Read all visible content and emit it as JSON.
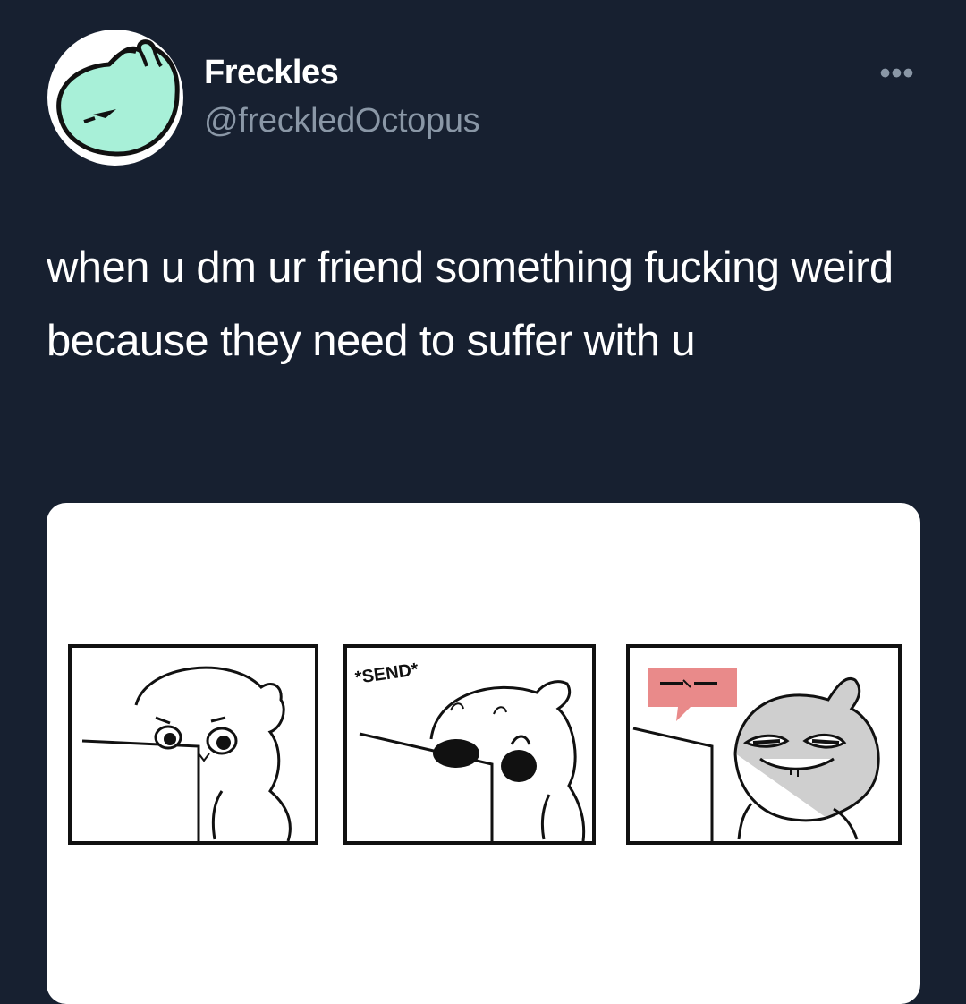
{
  "tweet": {
    "display_name": "Freckles",
    "handle": "@freckledOctopus",
    "more_label": "•••",
    "text": "when u dm ur friend something fucking weird because they need to suffer with u"
  },
  "comic": {
    "panel_2_caption": "*SEND*"
  },
  "icons": {
    "avatar": "bunny-blob-avatar-icon",
    "more": "more-horizontal-icon"
  },
  "colors": {
    "background": "#172030",
    "text": "#ffffff",
    "secondary_text": "#8a97a6",
    "avatar_mint": "#a8f0d8",
    "speech_bubble_red": "#e98a8a"
  }
}
